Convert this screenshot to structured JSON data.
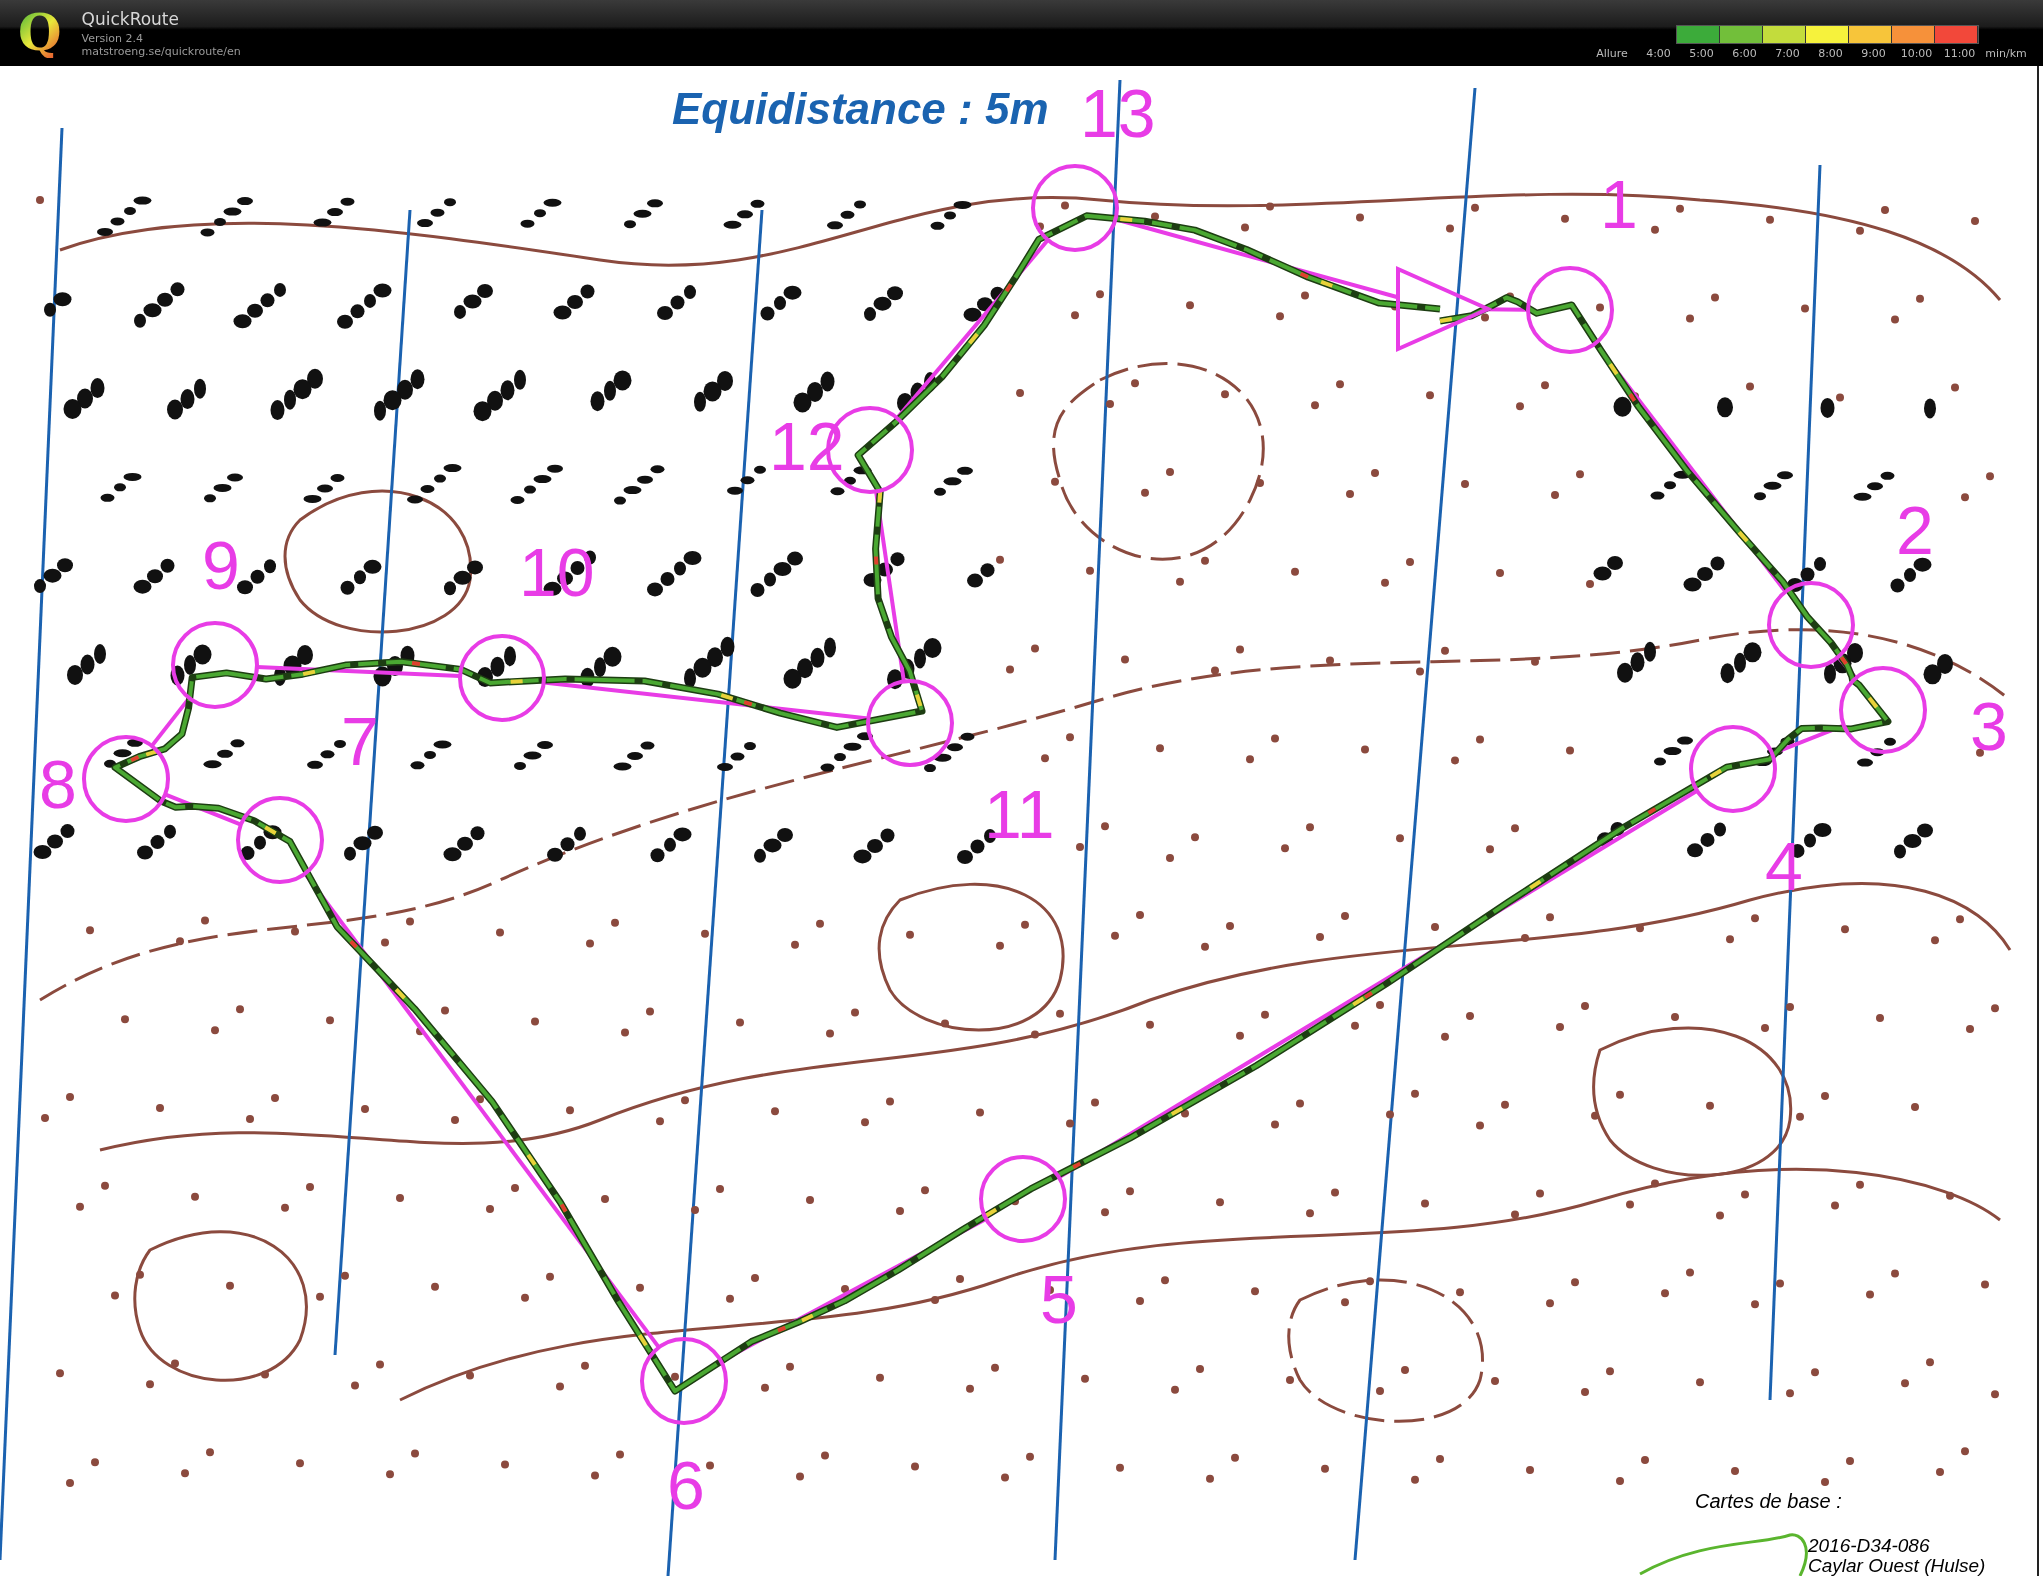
{
  "header": {
    "logo": "Q",
    "app_name": "QuickRoute",
    "version": "Version 2.4",
    "url": "matstroeng.se/quickroute/en"
  },
  "pace_legend": {
    "label": "Allure",
    "ticks": [
      "4:00",
      "5:00",
      "6:00",
      "7:00",
      "8:00",
      "9:00",
      "10:00",
      "11:00"
    ],
    "unit": "min/km"
  },
  "map": {
    "title": "Equidistance : 5m",
    "controls": [
      {
        "kind": "start"
      },
      {
        "kind": "control",
        "number": "1"
      },
      {
        "kind": "control",
        "number": "2"
      },
      {
        "kind": "control",
        "number": "3"
      },
      {
        "kind": "control",
        "number": "4"
      },
      {
        "kind": "control",
        "number": "5"
      },
      {
        "kind": "control",
        "number": "6"
      },
      {
        "kind": "control",
        "number": "7"
      },
      {
        "kind": "control",
        "number": "8"
      },
      {
        "kind": "control",
        "number": "9"
      },
      {
        "kind": "control",
        "number": "10"
      },
      {
        "kind": "control",
        "number": "11"
      },
      {
        "kind": "control",
        "number": "12"
      },
      {
        "kind": "control",
        "number": "13"
      }
    ],
    "legend": {
      "title": "Cartes de base :",
      "lines": [
        "2016-D34-086",
        "Caylar Ouest (Hulse)"
      ]
    }
  }
}
